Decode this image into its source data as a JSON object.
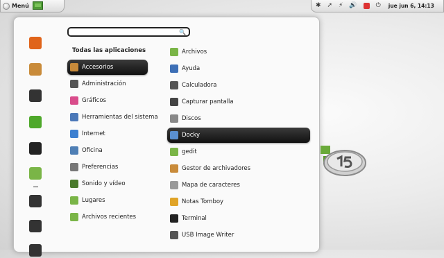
{
  "panel": {
    "menu_label": "Menú",
    "clock": "jue jun  6, 14:13",
    "tray": [
      "brightness-icon",
      "pointer-icon",
      "network-icon",
      "volume-icon",
      "update-icon",
      "power-icon"
    ]
  },
  "search": {
    "value": "",
    "placeholder": ""
  },
  "favorites": [
    {
      "icon": "firefox-icon",
      "color": "#e0641a"
    },
    {
      "icon": "software-manager-icon",
      "color": "#c98b3a"
    },
    {
      "icon": "update-manager-icon",
      "color": "#333333"
    },
    {
      "icon": "terminal-hash-icon",
      "color": "#4ea82a"
    },
    {
      "icon": "terminal-icon",
      "color": "#222222"
    },
    {
      "icon": "folder-icon",
      "color": "#7ab547"
    },
    {
      "icon": "lock-screen-icon",
      "color": "#333333"
    },
    {
      "icon": "logout-icon",
      "color": "#333333"
    },
    {
      "icon": "shutdown-icon",
      "color": "#333333"
    }
  ],
  "categories_heading": "Todas las aplicaciones",
  "categories": [
    {
      "label": "Accesorios",
      "icon": "accessories-icon",
      "color": "#c78a3a",
      "selected": true
    },
    {
      "label": "Administración",
      "icon": "administration-icon",
      "color": "#555555"
    },
    {
      "label": "Gráficos",
      "icon": "graphics-icon",
      "color": "#d94c8b"
    },
    {
      "label": "Herramientas del sistema",
      "icon": "system-tools-icon",
      "color": "#4b78b8"
    },
    {
      "label": "Internet",
      "icon": "internet-icon",
      "color": "#3b7fd0"
    },
    {
      "label": "Oficina",
      "icon": "office-icon",
      "color": "#4f7fb5"
    },
    {
      "label": "Preferencias",
      "icon": "preferences-icon",
      "color": "#777777"
    },
    {
      "label": "Sonido y vídeo",
      "icon": "sound-video-icon",
      "color": "#4a7a2c"
    },
    {
      "label": "Lugares",
      "icon": "places-icon",
      "color": "#7ab547"
    },
    {
      "label": "Archivos recientes",
      "icon": "recent-files-icon",
      "color": "#7ab547"
    }
  ],
  "applications": [
    {
      "label": "Archivos",
      "icon": "files-icon",
      "color": "#7ab547"
    },
    {
      "label": "Ayuda",
      "icon": "help-icon",
      "color": "#3d6fb6"
    },
    {
      "label": "Calculadora",
      "icon": "calculator-icon",
      "color": "#555555"
    },
    {
      "label": "Capturar pantalla",
      "icon": "screenshot-icon",
      "color": "#444444"
    },
    {
      "label": "Discos",
      "icon": "disks-icon",
      "color": "#888888"
    },
    {
      "label": "Docky",
      "icon": "docky-icon",
      "color": "#5a8fd0",
      "selected": true
    },
    {
      "label": "gedit",
      "icon": "gedit-icon",
      "color": "#7ab547"
    },
    {
      "label": "Gestor de archivadores",
      "icon": "archive-manager-icon",
      "color": "#c98b3a"
    },
    {
      "label": "Mapa de caracteres",
      "icon": "character-map-icon",
      "color": "#999999"
    },
    {
      "label": "Notas Tomboy",
      "icon": "tomboy-icon",
      "color": "#e0a428"
    },
    {
      "label": "Terminal",
      "icon": "terminal-icon",
      "color": "#222222"
    },
    {
      "label": "USB Image Writer",
      "icon": "usb-writer-icon",
      "color": "#555555"
    }
  ],
  "colors": {
    "selection_bg": "#1a1a1a",
    "mint_green": "#6aaa3a"
  }
}
